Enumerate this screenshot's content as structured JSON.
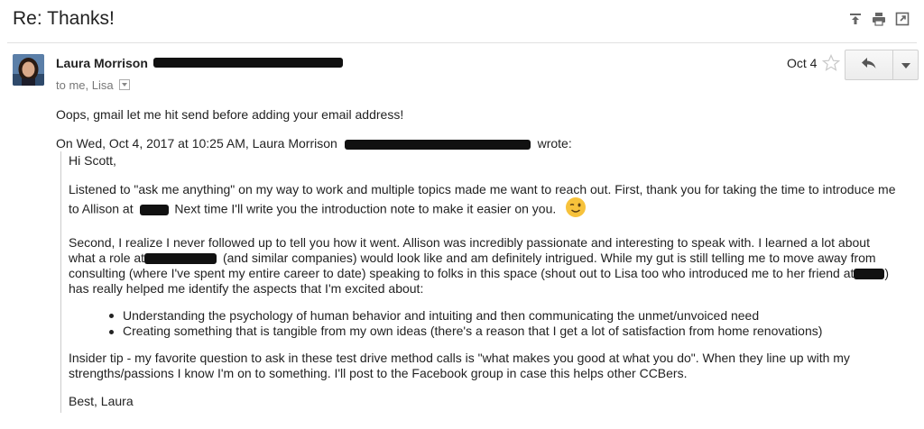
{
  "email": {
    "subject": "Re: Thanks!",
    "sender_name": "Laura Morrison",
    "recipients": "to me, Lisa",
    "date": "Oct 4",
    "intro": "Oops, gmail let me hit send before adding your email address!",
    "quote_header_pre": "On Wed, Oct 4, 2017 at 10:25 AM, Laura Morrison",
    "quote_header_post": "wrote:",
    "quoted": {
      "greeting": "Hi Scott,",
      "p1_line1": "Listened to \"ask me anything\" on my way to work and multiple topics made me want to reach out. First, thank you for taking the time to introduce me",
      "p1_line2_pre": "to Allison at",
      "p1_line2_post": "Next time I'll write you the introduction note to make it easier on you.",
      "p2_line1": "Second, I realize I never followed up to tell you how it went. Allison was incredibly passionate and interesting to speak with. I learned a lot about",
      "p2_line2_pre": "what a role at",
      "p2_line2_post": "(and similar companies) would look like and am definitely intrigued. While my gut is still telling me to move away from",
      "p2_line3_pre": "consulting (where I've spent my entire career to date) speaking to folks in this space (shout out to Lisa too who introduced me to her friend at",
      "p2_line3_post": ")",
      "p2_line4": "has really helped me identify the aspects that I'm excited about:",
      "bullets": [
        "Understanding the psychology of human behavior and intuiting and then communicating the unmet/unvoiced need",
        "Creating something that is tangible from my own ideas (there's a reason that I get a lot of satisfaction from home renovations)"
      ],
      "p3_line1": "Insider tip - my favorite question to ask in these test drive method calls is \"what makes you good at what you do\". When they line up with my",
      "p3_line2": "strengths/passions I know I'm on to something. I'll post to the Facebook group in case this helps other CCBers.",
      "signoff": "Best, Laura"
    }
  },
  "icons": [
    "print-all-icon",
    "print-icon",
    "new-window-icon",
    "star-icon",
    "reply-icon",
    "more-dropdown-icon",
    "winking-emoji"
  ]
}
